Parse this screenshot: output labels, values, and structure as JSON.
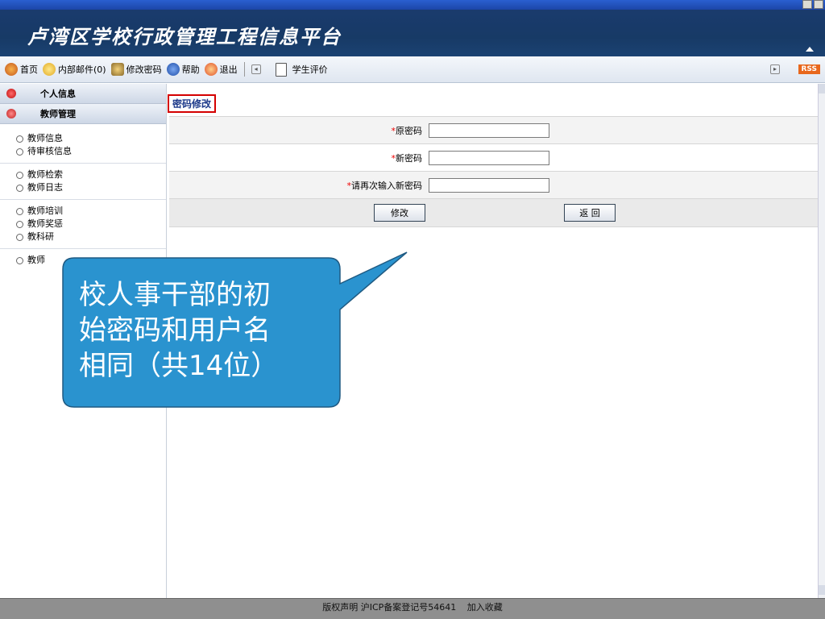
{
  "header": {
    "title": "卢湾区学校行政管理工程信息平台"
  },
  "toolbar": {
    "items": [
      {
        "label": "首页",
        "icon": "home-icon"
      },
      {
        "label": "内部邮件(0)",
        "icon": "mail-icon"
      },
      {
        "label": "修改密码",
        "icon": "key-icon"
      },
      {
        "label": "帮助",
        "icon": "help-icon"
      },
      {
        "label": "退出",
        "icon": "exit-icon"
      },
      {
        "label": "学生评价",
        "icon": "document-icon"
      }
    ],
    "rss": "RSS"
  },
  "sidebar": {
    "sections": [
      {
        "label": "个人信息"
      },
      {
        "label": "教师管理"
      }
    ],
    "groups": [
      [
        "教师信息",
        "待审核信息"
      ],
      [
        "教师检索",
        "教师日志"
      ],
      [
        "教师培训",
        "教师奖惩",
        "教科研"
      ],
      [
        "教师"
      ]
    ]
  },
  "form": {
    "title": "密码修改",
    "old_password_label": "原密码",
    "new_password_label": "新密码",
    "confirm_password_label": "请再次输入新密码",
    "required_mark": "*",
    "submit_label": "修改",
    "back_label": "返 回"
  },
  "footer": {
    "copyright": "版权声明",
    "icp": "沪ICP备案登记号54641",
    "favorite": "加入收藏"
  },
  "callout": {
    "line1": "校人事干部的初",
    "line2": "始密码和用户名",
    "line3": "相同（共14位）"
  },
  "colors": {
    "header_bg": "#173a66",
    "callout_fill": "#2a93cf",
    "form_title_border": "#d40000",
    "rss": "#e8671c"
  }
}
